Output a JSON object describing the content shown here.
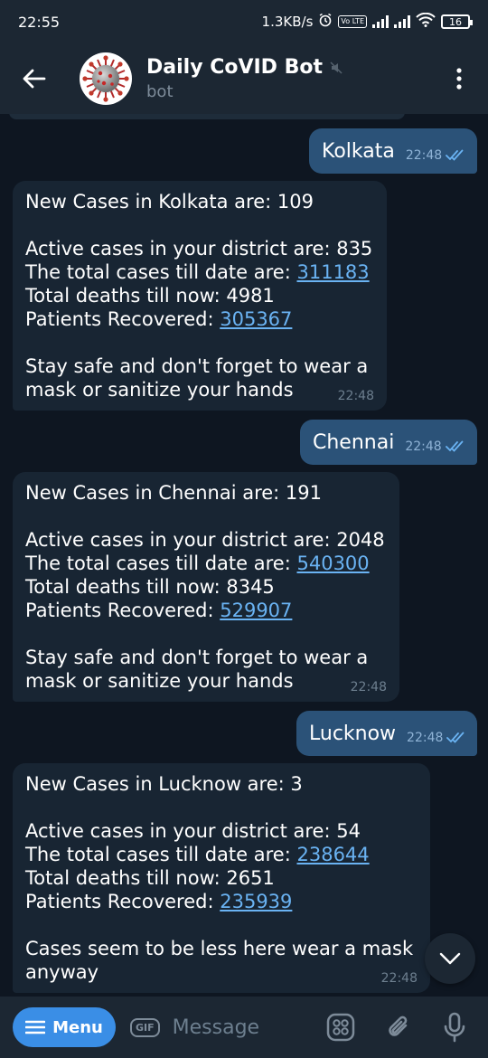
{
  "status_bar": {
    "time": "22:55",
    "speed": "1.3KB/s",
    "volte": "Vo LTE",
    "battery": "16"
  },
  "header": {
    "title": "Daily CoVID Bot",
    "subtitle": "bot"
  },
  "messages": [
    {
      "type": "out",
      "text": "Kolkata",
      "time": "22:48"
    },
    {
      "type": "in",
      "time": "22:48",
      "lines": {
        "l1": "New Cases in Kolkata are: 109",
        "l2": "Active cases in your district are: 835",
        "l3_label": "The total cases till date are: ",
        "l3_value": "311183",
        "l4": "Total deaths till now: 4981",
        "l5_label": "Patients Recovered: ",
        "l5_value": "305367",
        "l6": "Stay safe and don't forget to wear a",
        "l7": "mask or sanitize your hands"
      }
    },
    {
      "type": "out",
      "text": "Chennai",
      "time": "22:48"
    },
    {
      "type": "in",
      "time": "22:48",
      "lines": {
        "l1": "New Cases in Chennai are: 191",
        "l2": "Active cases in your district are: 2048",
        "l3_label": "The total cases till date are: ",
        "l3_value": "540300",
        "l4": "Total deaths till now: 8345",
        "l5_label": "Patients Recovered: ",
        "l5_value": "529907",
        "l6": "Stay safe and don't forget to wear a",
        "l7": "mask or sanitize your hands"
      }
    },
    {
      "type": "out",
      "text": "Lucknow",
      "time": "22:48"
    },
    {
      "type": "in",
      "time": "22:48",
      "lines": {
        "l1": "New Cases in Lucknow are: 3",
        "l2": "Active cases in your district are: 54",
        "l3_label": "The total cases till date are: ",
        "l3_value": "238644",
        "l4": "Total deaths till now: 2651",
        "l5_label": "Patients Recovered: ",
        "l5_value": "235939",
        "l6": "Cases seem to be less here wear a mask",
        "l7": "anyway"
      }
    }
  ],
  "composer": {
    "menu_label": "Menu",
    "gif_label": "GIF",
    "placeholder": "Message"
  },
  "colors": {
    "background": "#0e1621",
    "bar": "#1c2733",
    "outgoing_bubble": "#2b5278",
    "incoming_bubble": "#182533",
    "link": "#6ab3f3",
    "accent": "#3a8ee6"
  }
}
